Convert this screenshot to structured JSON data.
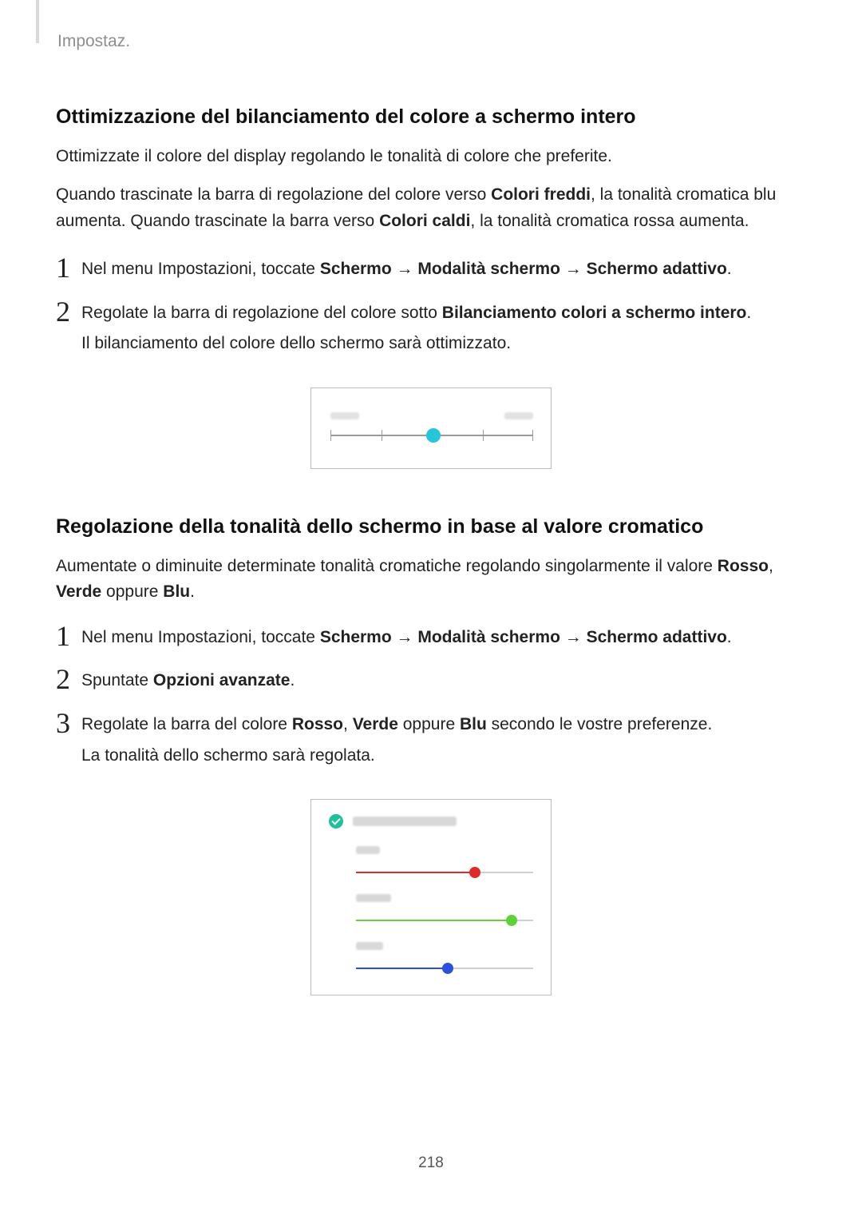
{
  "header": {
    "breadcrumb": "Impostaz."
  },
  "section1": {
    "heading": "Ottimizzazione del bilanciamento del colore a schermo intero",
    "p1": "Ottimizzate il colore del display regolando le tonalità di colore che preferite.",
    "p2_pre": "Quando trascinate la barra di regolazione del colore verso ",
    "p2_b1": "Colori freddi",
    "p2_mid": ", la tonalità cromatica blu aumenta. Quando trascinate la barra verso ",
    "p2_b2": "Colori caldi",
    "p2_post": ", la tonalità cromatica rossa aumenta.",
    "steps": [
      {
        "num": "1",
        "pre": "Nel menu Impostazioni, toccate ",
        "b1": "Schermo",
        "arr1": " → ",
        "b2": "Modalità schermo",
        "arr2": " → ",
        "b3": "Schermo adattivo",
        "post": "."
      },
      {
        "num": "2",
        "pre": "Regolate la barra di regolazione del colore sotto ",
        "b1": "Bilanciamento colori a schermo intero",
        "post": ".",
        "sub": "Il bilanciamento del colore dello schermo sarà ottimizzato."
      }
    ],
    "diagram": {
      "left_label": "Cool",
      "right_label": "Warm"
    }
  },
  "section2": {
    "heading": "Regolazione della tonalità dello schermo in base al valore cromatico",
    "p1_pre": "Aumentate o diminuite determinate tonalità cromatiche regolando singolarmente il valore ",
    "p1_b1": "Rosso",
    "p1_mid1": ", ",
    "p1_b2": "Verde",
    "p1_mid2": " oppure ",
    "p1_b3": "Blu",
    "p1_post": ".",
    "steps": [
      {
        "num": "1",
        "pre": "Nel menu Impostazioni, toccate ",
        "b1": "Schermo",
        "arr1": " → ",
        "b2": "Modalità schermo",
        "arr2": " → ",
        "b3": "Schermo adattivo",
        "post": "."
      },
      {
        "num": "2",
        "pre": "Spuntate ",
        "b1": "Opzioni avanzate",
        "post": "."
      },
      {
        "num": "3",
        "pre": "Regolate la barra del colore ",
        "b1": "Rosso",
        "mid1": ", ",
        "b2": "Verde",
        "mid2": " oppure ",
        "b3": "Blu",
        "post": " secondo le vostre preferenze.",
        "sub": "La tonalità dello schermo sarà regolata."
      }
    ],
    "diagram": {
      "header_label": "Advanced options",
      "sliders": {
        "red": {
          "label": "Red",
          "fill_color": "#e02a2a",
          "thumb_color": "#e02a2a",
          "value_pct": 67
        },
        "green": {
          "label": "Green",
          "fill_color": "#5fd23a",
          "thumb_color": "#5fd23a",
          "value_pct": 88
        },
        "blue": {
          "label": "Blue",
          "fill_color": "#2a52e0",
          "thumb_color": "#2a52e0",
          "value_pct": 52
        }
      }
    }
  },
  "footer": {
    "page_number": "218"
  }
}
